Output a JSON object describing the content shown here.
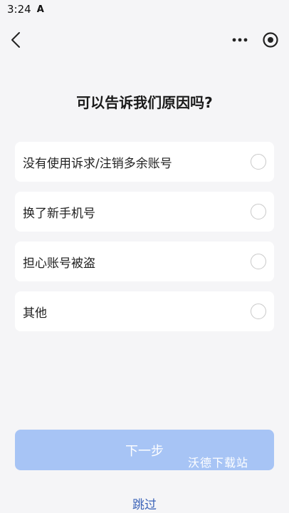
{
  "status_bar": {
    "time": "3:24",
    "notification_icon": "A"
  },
  "nav": {
    "back_icon": "chevron-left-icon",
    "more_icon": "more-dots-icon",
    "target_icon": "target-circle-icon"
  },
  "page": {
    "title": "可以告诉我们原因吗?"
  },
  "options": [
    {
      "label": "没有使用诉求/注销多余账号",
      "selected": false
    },
    {
      "label": "换了新手机号",
      "selected": false
    },
    {
      "label": "担心账号被盗",
      "selected": false
    },
    {
      "label": "其他",
      "selected": false
    }
  ],
  "actions": {
    "next_label": "下一步",
    "skip_label": "跳过"
  },
  "watermark": "沃德下载站",
  "colors": {
    "background": "#f5f5f7",
    "button_disabled": "#a7c4f5",
    "link": "#3b63b8"
  }
}
